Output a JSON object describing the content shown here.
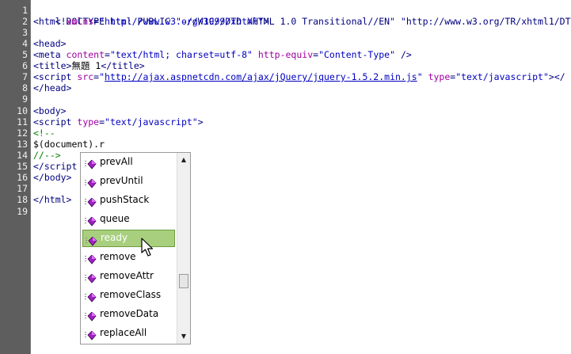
{
  "line_numbers": [
    "1",
    "2",
    "3",
    "4",
    "5",
    "6",
    "7",
    "8",
    "9",
    "10",
    "11",
    "12",
    "13",
    "14",
    "15",
    "16",
    "17",
    "18",
    "19"
  ],
  "code": {
    "l1": "<!DOCTYPE html PUBLIC \"-//W3C//DTD XHTML 1.0 Transitional//EN\" \"http://www.w3.org/TR/xhtml1/DTD/x",
    "l2_open": "<html ",
    "l2_attr": "xmlns",
    "l2_eq": "=",
    "l2_val": "\"http://www.w3.org/1999/xhtml\"",
    "l2_close": ">",
    "l4": "<head>",
    "l5_open": "<meta ",
    "l5_attr1": "content",
    "l5_eq": "=",
    "l5_val1": "\"text/html; charset=utf-8\"",
    "l5_attr2": " http-equiv",
    "l5_val2": "\"Content-Type\"",
    "l5_close": " />",
    "l6_open": "<title>",
    "l6_text": "無題 1",
    "l6_close": "</title>",
    "l7_open": "<script ",
    "l7_attr1": "src",
    "l7_q": "\"",
    "l7_url": "http://ajax.aspnetcdn.com/ajax/jQuery/jquery-1.5.2.min.js",
    "l7_attr2": " type",
    "l7_val2": "\"text/javascript\"",
    "l7_close": "></",
    "l8": "</head>",
    "l10": "<body>",
    "l11_open": "<script ",
    "l11_attr": "type",
    "l11_val": "\"text/javascript\"",
    "l11_close": ">",
    "l12": "<!--",
    "l13": "$(document).r",
    "l14": "//-->",
    "l15": "</script",
    "l16": "</body>",
    "l18": "</html>"
  },
  "autocomplete": {
    "items": [
      "prevAll",
      "prevUntil",
      "pushStack",
      "queue",
      "ready",
      "remove",
      "removeAttr",
      "removeClass",
      "removeData",
      "replaceAll"
    ],
    "selected": "ready",
    "icon": "method-icon",
    "scroll_position": 0.72
  },
  "colors": {
    "tag": "#000080",
    "attribute": "#a000a0",
    "string": "#0000c0",
    "comment": "#008000",
    "selection": "#a8cf7e"
  }
}
